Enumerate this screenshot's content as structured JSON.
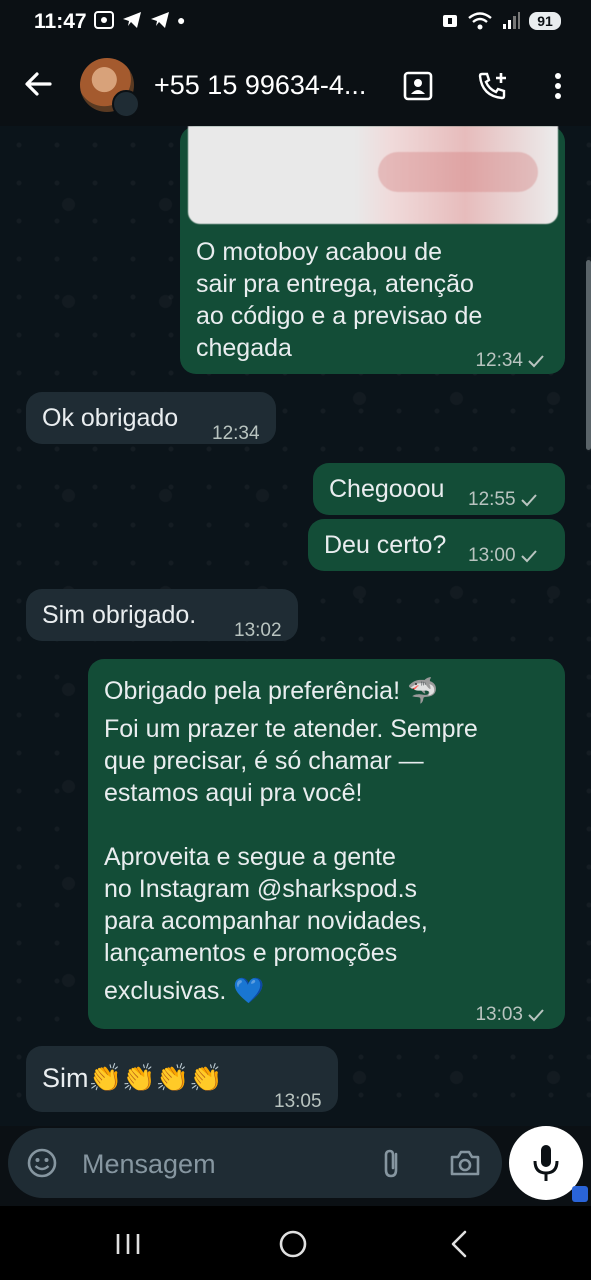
{
  "status_bar": {
    "time": "11:47",
    "battery": "91",
    "icons": [
      "screenshot-icon",
      "telegram-icon",
      "telegram-icon",
      "dot-icon",
      "sim-icon",
      "wifi-icon",
      "signal-icon"
    ]
  },
  "header": {
    "contact_name": "+55 15 99634-4...",
    "icons": [
      "back-arrow-icon",
      "contact-card-icon",
      "add-call-icon",
      "more-vertical-icon"
    ]
  },
  "messages": [
    {
      "dir": "out",
      "text": [
        "O motoboy acabou de",
        "sair pra entrega, atenção",
        "ao código e a previsao de",
        "chegada"
      ],
      "time": "12:34",
      "has_image": true
    },
    {
      "dir": "in",
      "text": [
        "Ok obrigado"
      ],
      "time": "12:34"
    },
    {
      "dir": "out",
      "text": [
        "Chegooou"
      ],
      "time": "12:55"
    },
    {
      "dir": "out",
      "text": [
        "Deu certo?"
      ],
      "time": "13:00"
    },
    {
      "dir": "in",
      "text": [
        "Sim obrigado."
      ],
      "time": "13:02"
    },
    {
      "dir": "out",
      "text": [
        "Obrigado pela preferência! 🦈",
        "Foi um prazer te atender. Sempre",
        "que precisar, é só chamar —",
        "estamos aqui pra você!",
        "",
        "Aproveita e segue a gente",
        "no Instagram @sharkspod.s",
        "para acompanhar novidades,",
        "lançamentos e promoções",
        "exclusivas. 💙"
      ],
      "time": "13:03"
    },
    {
      "dir": "in",
      "text": [
        "Sim👏👏👏👏"
      ],
      "time": "13:05"
    }
  ],
  "input": {
    "placeholder": "Mensagem"
  },
  "colors": {
    "outgoing_bubble": "#134d37",
    "incoming_bubble": "#1f2c34",
    "chat_background": "#0b141a",
    "time_text": "#b9c4c0"
  }
}
